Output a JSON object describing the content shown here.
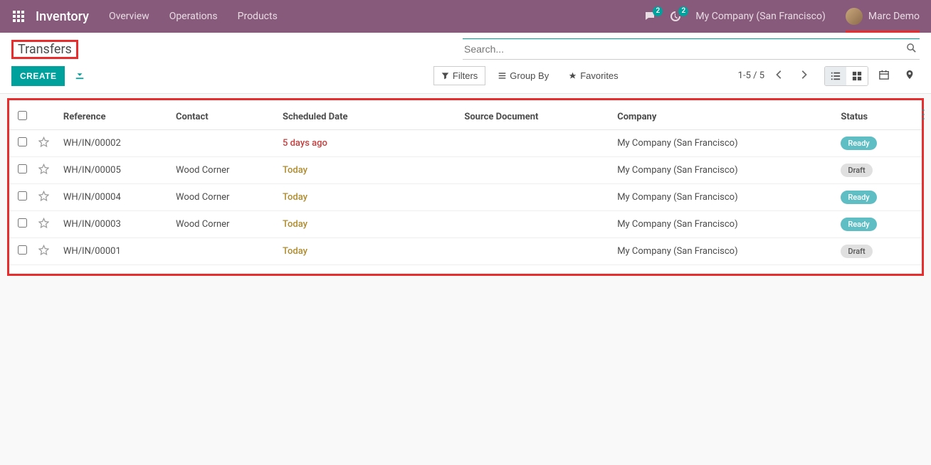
{
  "nav": {
    "brand": "Inventory",
    "links": [
      "Overview",
      "Operations",
      "Products"
    ],
    "msg_badge": "2",
    "activity_badge": "2",
    "company": "My Company (San Francisco)",
    "user": "Marc Demo"
  },
  "page": {
    "title": "Transfers",
    "create": "CREATE",
    "search_placeholder": "Search..."
  },
  "toolbar": {
    "filters": "Filters",
    "group_by": "Group By",
    "favorites": "Favorites",
    "pager": "1-5 / 5"
  },
  "table": {
    "headers": {
      "reference": "Reference",
      "contact": "Contact",
      "scheduled": "Scheduled Date",
      "source": "Source Document",
      "company": "Company",
      "status": "Status"
    },
    "rows": [
      {
        "reference": "WH/IN/00002",
        "contact": "",
        "scheduled": "5 days ago",
        "date_class": "overdue",
        "source": "",
        "company": "My Company (San Francisco)",
        "status": "Ready",
        "status_kind": "ready"
      },
      {
        "reference": "WH/IN/00005",
        "contact": "Wood Corner",
        "scheduled": "Today",
        "date_class": "today",
        "source": "",
        "company": "My Company (San Francisco)",
        "status": "Draft",
        "status_kind": "draft"
      },
      {
        "reference": "WH/IN/00004",
        "contact": "Wood Corner",
        "scheduled": "Today",
        "date_class": "today",
        "source": "",
        "company": "My Company (San Francisco)",
        "status": "Ready",
        "status_kind": "ready"
      },
      {
        "reference": "WH/IN/00003",
        "contact": "Wood Corner",
        "scheduled": "Today",
        "date_class": "today",
        "source": "",
        "company": "My Company (San Francisco)",
        "status": "Ready",
        "status_kind": "ready"
      },
      {
        "reference": "WH/IN/00001",
        "contact": "",
        "scheduled": "Today",
        "date_class": "today",
        "source": "",
        "company": "My Company (San Francisco)",
        "status": "Draft",
        "status_kind": "draft"
      }
    ]
  }
}
